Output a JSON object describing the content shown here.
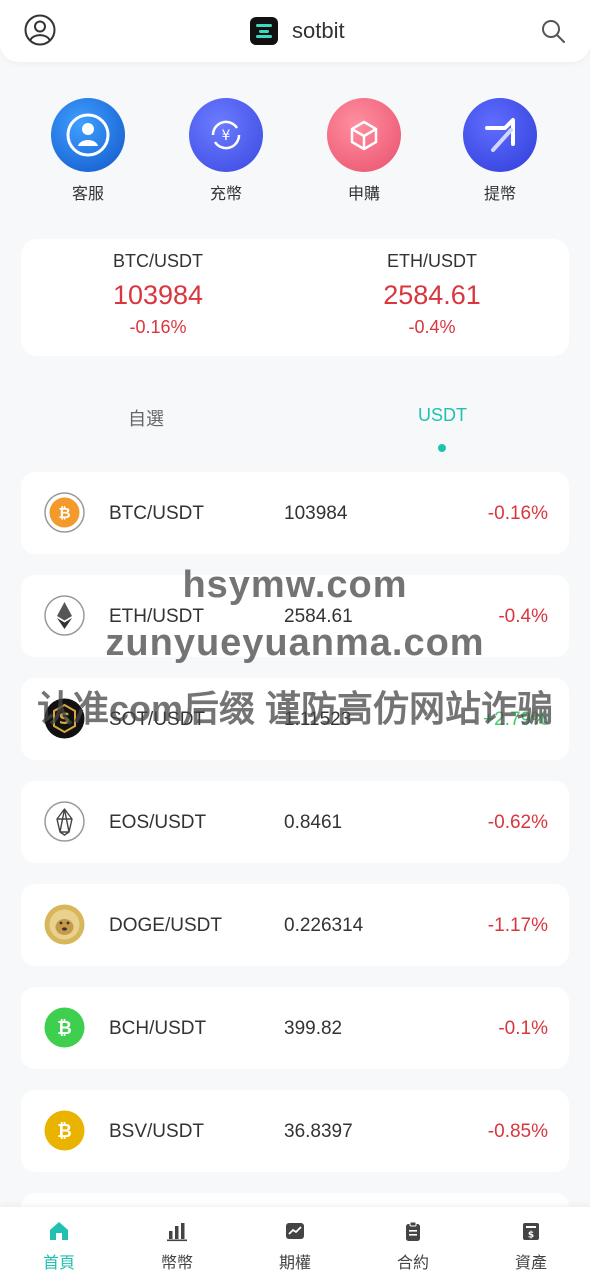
{
  "header": {
    "brand": "sotbit",
    "icons": [
      "user-icon",
      "search-icon"
    ]
  },
  "quick_actions": [
    {
      "label": "客服",
      "icon": "customer-service-icon",
      "color": "#1e6fd9"
    },
    {
      "label": "充幣",
      "icon": "deposit-icon",
      "color": "#4a5ae8"
    },
    {
      "label": "申購",
      "icon": "subscribe-box-icon",
      "color": "#f0607a"
    },
    {
      "label": "提幣",
      "icon": "withdraw-arrow-icon",
      "color": "#3f4fe6"
    }
  ],
  "ticker": [
    {
      "pair": "BTC/USDT",
      "price": "103984",
      "change": "-0.16%"
    },
    {
      "pair": "ETH/USDT",
      "price": "2584.61",
      "change": "-0.4%"
    }
  ],
  "tabs": {
    "favorites": "自選",
    "usdt": "USDT",
    "active": "usdt"
  },
  "markets": [
    {
      "pair": "BTC/USDT",
      "price": "103984",
      "change": "-0.16%",
      "dir": "down",
      "icon": "btc-icon"
    },
    {
      "pair": "ETH/USDT",
      "price": "2584.61",
      "change": "-0.4%",
      "dir": "down",
      "icon": "eth-icon"
    },
    {
      "pair": "SOT/USDT",
      "price": "1.11523",
      "change": "+2.79%",
      "dir": "up",
      "icon": "sot-icon"
    },
    {
      "pair": "EOS/USDT",
      "price": "0.8461",
      "change": "-0.62%",
      "dir": "down",
      "icon": "eos-icon"
    },
    {
      "pair": "DOGE/USDT",
      "price": "0.226314",
      "change": "-1.17%",
      "dir": "down",
      "icon": "doge-icon"
    },
    {
      "pair": "BCH/USDT",
      "price": "399.82",
      "change": "-0.1%",
      "dir": "down",
      "icon": "bch-icon"
    },
    {
      "pair": "BSV/USDT",
      "price": "36.8397",
      "change": "-0.85%",
      "dir": "down",
      "icon": "bsv-icon"
    }
  ],
  "watermark": {
    "line1": "hsymw.com",
    "line2": "zunyueyuanma.com",
    "line3": "认准com后缀 谨防高仿网站诈骗"
  },
  "bottom_nav": [
    {
      "label": "首頁",
      "icon": "home-icon",
      "active": true
    },
    {
      "label": "幣幣",
      "icon": "bar-chart-icon",
      "active": false
    },
    {
      "label": "期權",
      "icon": "trend-icon",
      "active": false
    },
    {
      "label": "合約",
      "icon": "clipboard-icon",
      "active": false
    },
    {
      "label": "資產",
      "icon": "wallet-icon",
      "active": false
    }
  ],
  "colors": {
    "accent": "#20c1b0",
    "down": "#d9363e",
    "up": "#3ecf6b"
  }
}
